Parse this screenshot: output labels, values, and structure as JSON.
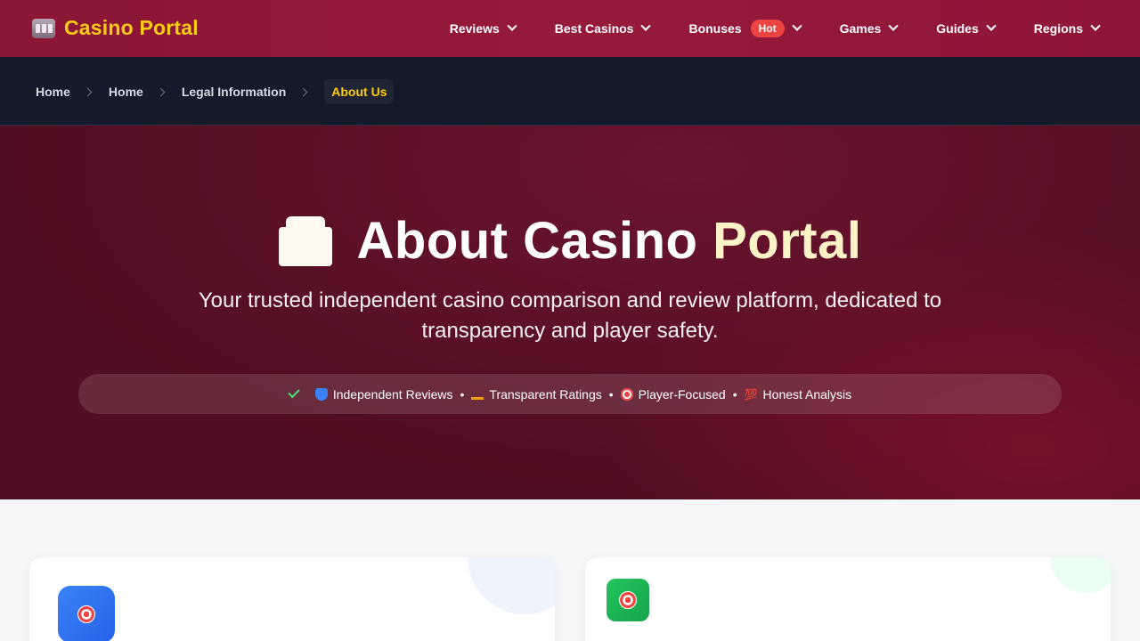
{
  "brand": {
    "name": "Casino Portal",
    "icon": "slot-machine-icon"
  },
  "nav": {
    "items": [
      {
        "label": "Reviews"
      },
      {
        "label": "Best Casinos"
      },
      {
        "label": "Bonuses",
        "badge": "Hot"
      },
      {
        "label": "Games"
      },
      {
        "label": "Guides"
      },
      {
        "label": "Regions"
      }
    ]
  },
  "breadcrumb": {
    "items": [
      "Home",
      "Home",
      "Legal Information"
    ],
    "current": "About Us"
  },
  "hero": {
    "title_main": "About Casino",
    "title_accent": "Portal",
    "subtitle": "Your trusted independent casino comparison and review platform, dedicated to transparency and player safety.",
    "features": [
      "Independent Reviews",
      "Transparent Ratings",
      "Player-Focused",
      "Honest Analysis"
    ],
    "separator": "•"
  },
  "colors": {
    "nav_bg": "#8a1535",
    "brand_text": "#facc15",
    "crumb_bg": "#131a2a",
    "hero_bg": "#5c1026",
    "hot_badge": "#ef4444",
    "card1_badge": "#3b82f6",
    "card2_badge": "#22c55e"
  },
  "cards": [
    {
      "icon": "target-icon"
    },
    {
      "icon": "target-icon"
    }
  ]
}
